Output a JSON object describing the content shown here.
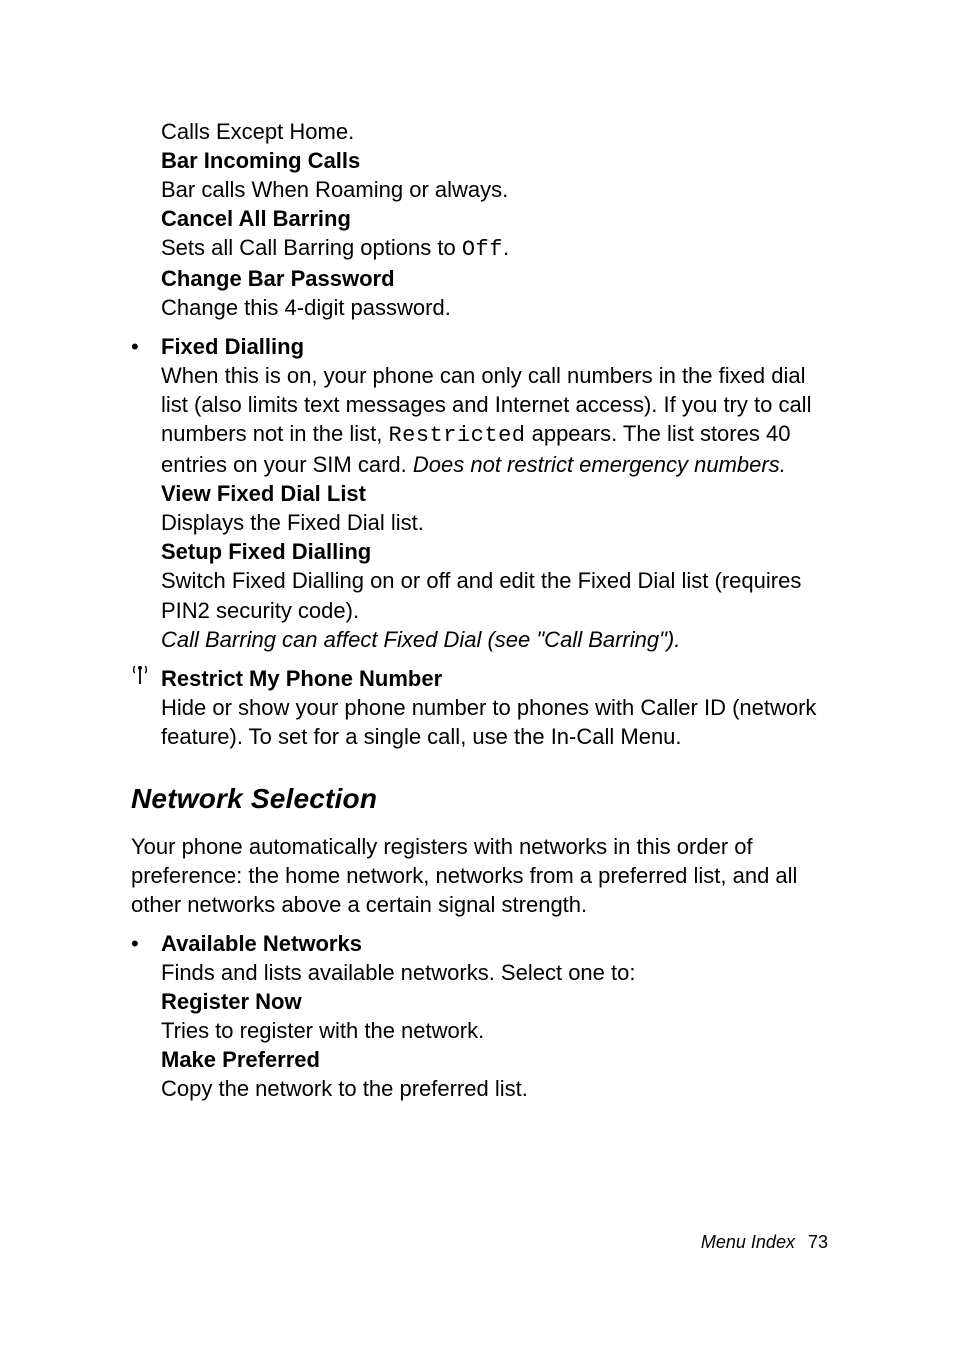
{
  "top_indent": {
    "line1": "Calls Except Home.",
    "bar_incoming_heading": "Bar Incoming Calls",
    "bar_incoming_text": "Bar calls When Roaming or always.",
    "cancel_all_heading": "Cancel All Barring",
    "cancel_all_text_pre": "Sets all Call Barring options to ",
    "cancel_all_mono": "Off",
    "cancel_all_text_post": ".",
    "change_bar_heading": "Change Bar Password",
    "change_bar_text": "Change this 4-digit password."
  },
  "fixed_dialling": {
    "heading": "Fixed Dialling",
    "p1a": "When this is on, your phone can only call numbers in the fixed dial list (also limits text messages and Internet access). If you try to call numbers not in the list, ",
    "p1_mono": "Restricted",
    "p1b": " appears. The list stores 40 entries on your SIM card. ",
    "p1_italic": "Does not restrict emergency numbers.",
    "view_heading": "View Fixed Dial List",
    "view_text": "Displays the Fixed Dial list.",
    "setup_heading": "Setup Fixed Dialling",
    "setup_text1": "Switch Fixed Dialling on or off and edit the Fixed Dial list (requires PIN2 security code).",
    "setup_italic": "Call Barring can affect Fixed Dial (see \"Call Barring\")."
  },
  "restrict": {
    "heading": "Restrict My Phone Number",
    "text": "Hide or show your phone number to phones with Caller ID (network feature). To set for a single call, use the In-Call Menu."
  },
  "section_heading": "Network Selection",
  "section_intro": "Your phone automatically registers with networks in this order of preference: the home network, networks from a preferred list, and all other networks above a certain signal strength.",
  "available": {
    "heading": "Available Networks",
    "intro": "Finds and lists available networks. Select one to:",
    "reg_heading": "Register Now",
    "reg_text": "Tries to register with the network.",
    "pref_heading": "Make Preferred",
    "pref_text": "Copy the network to the preferred list."
  },
  "footer": {
    "label": "Menu Index",
    "page": "73"
  }
}
